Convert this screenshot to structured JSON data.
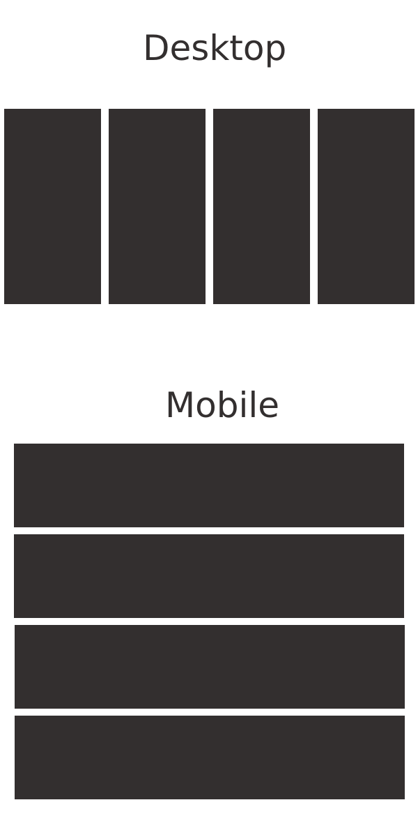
{
  "colors": {
    "background": "#ffffff",
    "block": "#332f2f",
    "text": "#332f2f"
  },
  "desktop": {
    "title": "Desktop",
    "block_count": 4
  },
  "mobile": {
    "title": "Mobile",
    "block_count": 4
  }
}
